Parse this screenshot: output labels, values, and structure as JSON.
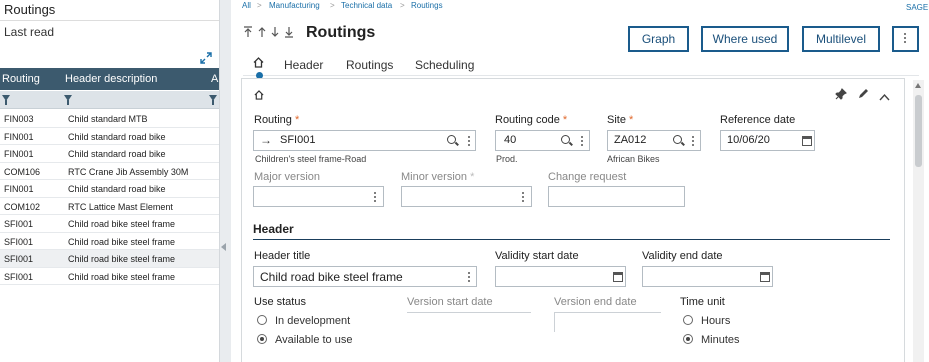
{
  "left_panel": {
    "title": "Routings",
    "last_read": "Last read",
    "columns": [
      "Routing",
      "Header description",
      "A"
    ],
    "rows": [
      {
        "routing": "FIN003",
        "description": "Child standard MTB"
      },
      {
        "routing": "FIN001",
        "description": "Child standard road bike"
      },
      {
        "routing": "FIN001",
        "description": "Child standard road bike"
      },
      {
        "routing": "COM106",
        "description": "RTC Crane Jib Assembly 30M"
      },
      {
        "routing": "FIN001",
        "description": "Child standard road bike"
      },
      {
        "routing": "COM102",
        "description": "RTC Lattice Mast Element"
      },
      {
        "routing": "SFI001",
        "description": "Child road bike steel frame"
      },
      {
        "routing": "SFI001",
        "description": "Child road bike steel frame"
      },
      {
        "routing": "SFI001",
        "description": "Child road bike steel frame"
      },
      {
        "routing": "SFI001",
        "description": "Child road bike steel frame"
      }
    ],
    "selected_row": 8
  },
  "breadcrumb": [
    "All",
    "Manufacturing",
    "Technical data",
    "Routings"
  ],
  "company": "SAGE",
  "page_title": "Routings",
  "actions": {
    "graph": "Graph",
    "where_used": "Where used",
    "multilevel": "Multilevel"
  },
  "tabs": [
    "Header",
    "Routings",
    "Scheduling"
  ],
  "form": {
    "routing": {
      "label": "Routing",
      "value": "SFI001",
      "sub": "Children's steel frame-Road"
    },
    "routing_code": {
      "label": "Routing code",
      "value": "40",
      "sub": "Prod."
    },
    "site": {
      "label": "Site",
      "value": "ZA012",
      "sub": "African Bikes"
    },
    "reference_date": {
      "label": "Reference date",
      "value": "10/06/20"
    },
    "major_version": {
      "label": "Major version",
      "value": ""
    },
    "minor_version": {
      "label": "Minor version",
      "value": ""
    },
    "change_request": {
      "label": "Change request",
      "value": ""
    },
    "header_section": "Header",
    "header_title": {
      "label": "Header title",
      "value": "Child road bike steel frame"
    },
    "validity_start": {
      "label": "Validity start date",
      "value": ""
    },
    "validity_end": {
      "label": "Validity end date",
      "value": ""
    },
    "use_status": {
      "label": "Use status",
      "options": [
        "In development",
        "Available to use"
      ],
      "selected": "Available to use"
    },
    "version_start": {
      "label": "Version start date"
    },
    "version_end": {
      "label": "Version end date"
    },
    "time_unit": {
      "label": "Time unit",
      "options": [
        "Hours",
        "Minutes"
      ],
      "selected": "Minutes"
    }
  },
  "icons": {
    "pin": "pin-icon",
    "edit": "pencil-icon",
    "collapse": "chevron-up-icon",
    "home": "home-icon"
  },
  "colors": {
    "header_bg": "#3c5a6e",
    "accent": "#1a6fa8",
    "button_border": "#1a5b8c",
    "required": "#e0672a"
  }
}
